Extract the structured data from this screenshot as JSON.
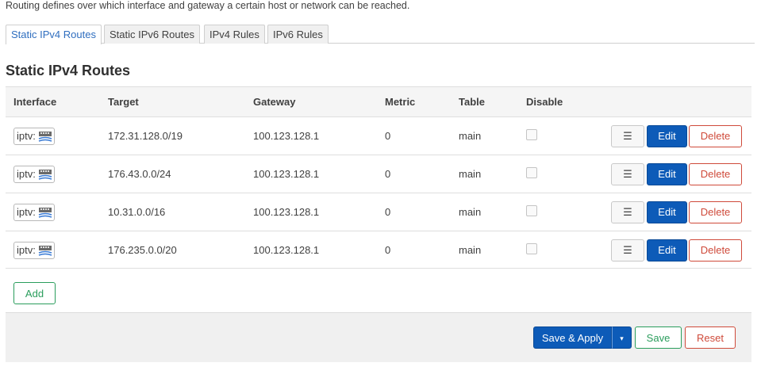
{
  "description": "Routing defines over which interface and gateway a certain host or network can be reached.",
  "tabs": [
    {
      "label": "Static IPv4 Routes",
      "active": true
    },
    {
      "label": "Static IPv6 Routes",
      "active": false
    },
    {
      "label": "IPv4 Rules",
      "active": false
    },
    {
      "label": "IPv6 Rules",
      "active": false
    }
  ],
  "section_title": "Static IPv4 Routes",
  "columns": {
    "interface": "Interface",
    "target": "Target",
    "gateway": "Gateway",
    "metric": "Metric",
    "table": "Table",
    "disable": "Disable"
  },
  "routes": [
    {
      "interface": "iptv:",
      "target": "172.31.128.0/19",
      "gateway": "100.123.128.1",
      "metric": "0",
      "table": "main",
      "disabled": false
    },
    {
      "interface": "iptv:",
      "target": "176.43.0.0/24",
      "gateway": "100.123.128.1",
      "metric": "0",
      "table": "main",
      "disabled": false
    },
    {
      "interface": "iptv:",
      "target": "10.31.0.0/16",
      "gateway": "100.123.128.1",
      "metric": "0",
      "table": "main",
      "disabled": false
    },
    {
      "interface": "iptv:",
      "target": "176.235.0.0/20",
      "gateway": "100.123.128.1",
      "metric": "0",
      "table": "main",
      "disabled": false
    }
  ],
  "row_buttons": {
    "drag": "☰",
    "edit": "Edit",
    "delete": "Delete"
  },
  "add_label": "Add",
  "footer": {
    "save_apply": "Save & Apply",
    "dropdown": "▾",
    "save": "Save",
    "reset": "Reset"
  },
  "icons": {
    "row_interface": "network-port-icon",
    "drag": "hamburger-icon"
  },
  "colors": {
    "primary": "#0d5bb8",
    "positive": "#2a9d5c",
    "negative": "#cf4a3a",
    "active_tab": "#2f6ebf"
  }
}
